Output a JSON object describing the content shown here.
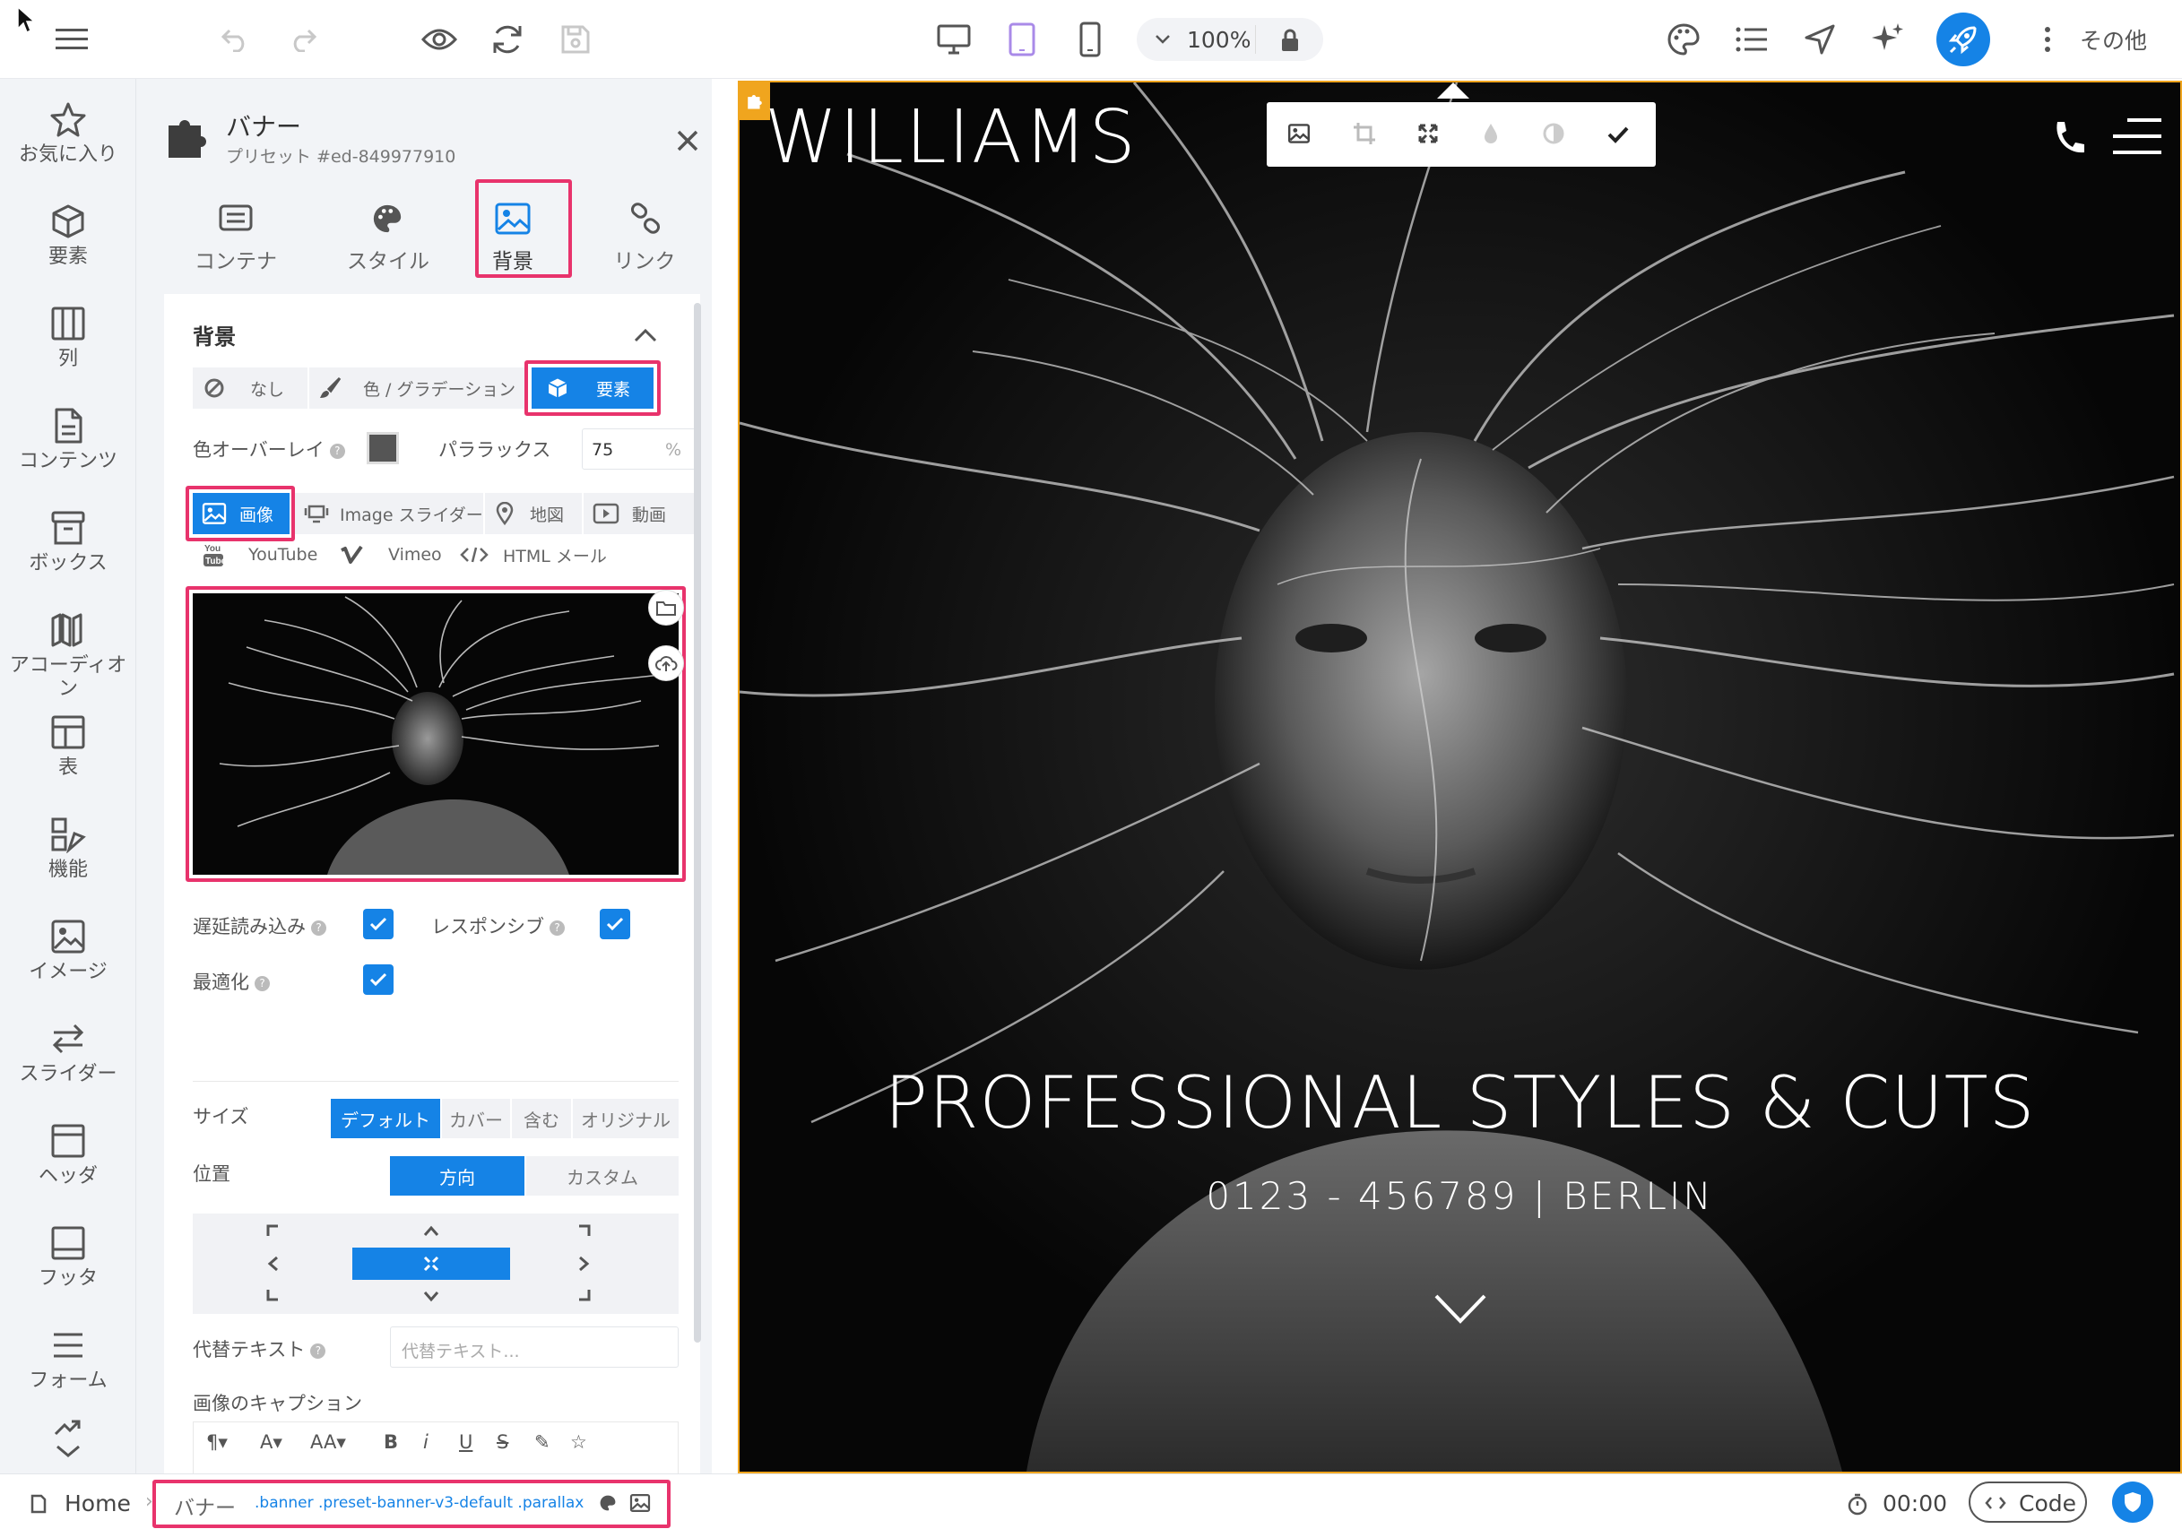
{
  "toolbar": {
    "zoom": "100%",
    "more_label": "その他"
  },
  "sidebar": {
    "items": [
      {
        "label": "お気に入り",
        "icon": "star-icon"
      },
      {
        "label": "要素",
        "icon": "cube-icon"
      },
      {
        "label": "列",
        "icon": "columns-icon"
      },
      {
        "label": "コンテンツ",
        "icon": "document-icon"
      },
      {
        "label": "ボックス",
        "icon": "box-icon"
      },
      {
        "label": "アコーディオン",
        "icon": "accordion-icon"
      },
      {
        "label": "表",
        "icon": "table-icon"
      },
      {
        "label": "機能",
        "icon": "features-icon"
      },
      {
        "label": "イメージ",
        "icon": "image-icon"
      },
      {
        "label": "スライダー",
        "icon": "slider-icon"
      },
      {
        "label": "ヘッダ",
        "icon": "header-icon"
      },
      {
        "label": "フッタ",
        "icon": "footer-icon"
      },
      {
        "label": "フォーム",
        "icon": "form-icon"
      }
    ]
  },
  "panel": {
    "title": "バナー",
    "subtitle": "プリセット #ed-849977910",
    "tabs": [
      {
        "label": "コンテナ"
      },
      {
        "label": "スタイル"
      },
      {
        "label": "背景"
      },
      {
        "label": "リンク"
      }
    ],
    "section_title": "背景",
    "bg_types": {
      "none": "なし",
      "color": "色 / グラデーション",
      "element": "要素"
    },
    "overlay_label": "色オーバーレイ",
    "parallax_label": "パララックス",
    "parallax_value": "75",
    "parallax_unit": "%",
    "media_types": {
      "image": "画像",
      "slider": "Image スライダー",
      "map": "地図",
      "video": "動画",
      "youtube": "YouTube",
      "vimeo": "Vimeo",
      "html": "HTML メール"
    },
    "lazy_label": "遅延読み込み",
    "responsive_label": "レスポンシブ",
    "optimize_label": "最適化",
    "size_label": "サイズ",
    "size_options": [
      "デフォルト",
      "カバー",
      "含む",
      "オリジナル"
    ],
    "position_label": "位置",
    "position_options": [
      "方向",
      "カスタム"
    ],
    "alt_label": "代替テキスト",
    "alt_placeholder": "代替テキスト...",
    "caption_label": "画像のキャプション"
  },
  "canvas": {
    "brand": "WILLIAMS",
    "headline": "PROFESSIONAL STYLES & CUTS",
    "subline": "0123 - 456789 | BERLIN"
  },
  "bottombar": {
    "home": "Home",
    "crumb_name": "バナー",
    "crumb_classes": ".banner .preset-banner-v3-default .parallax",
    "timer": "00:00",
    "code": "Code"
  },
  "colors": {
    "accent": "#1583e6",
    "highlight": "#e8336c",
    "selection": "#f0a51e",
    "purple": "#a98ae8"
  }
}
